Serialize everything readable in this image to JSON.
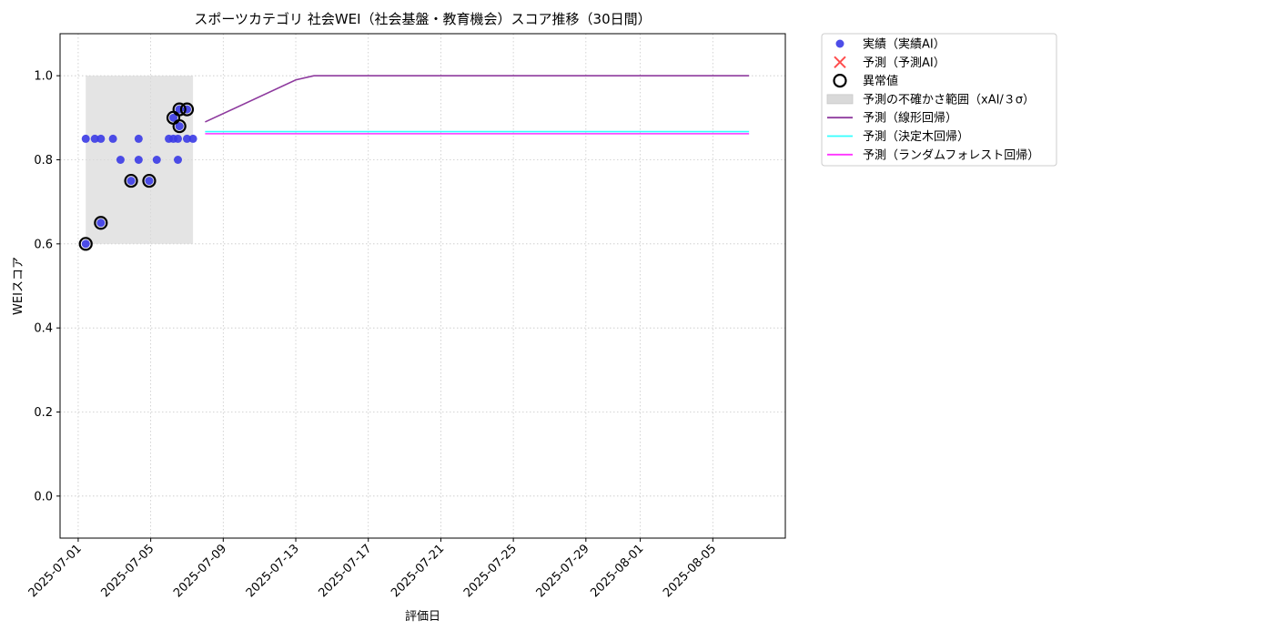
{
  "chart_data": {
    "type": "scatter",
    "title": "スポーツカテゴリ 社会WEI（社会基盤・教育機会）スコア推移（30日間）",
    "xlabel": "評価日",
    "ylabel": "WEIスコア",
    "xlim": [
      "2025-06-30",
      "2025-08-09"
    ],
    "ylim": [
      -0.1,
      1.1
    ],
    "yticks": [
      0.0,
      0.2,
      0.4,
      0.6,
      0.8,
      1.0
    ],
    "xticks": [
      "2025-07-01",
      "2025-07-05",
      "2025-07-09",
      "2025-07-13",
      "2025-07-17",
      "2025-07-21",
      "2025-07-25",
      "2025-07-29",
      "2025-08-01",
      "2025-08-05"
    ],
    "grid": true,
    "legend_position": "outside-top-right",
    "legend": [
      {
        "label": "実績（実績AI）",
        "kind": "dot",
        "color": "#3a3ae6"
      },
      {
        "label": "予測（予測AI）",
        "kind": "x",
        "color": "#ff4d4d"
      },
      {
        "label": "異常値",
        "kind": "ring",
        "color": "#000000"
      },
      {
        "label": "予測の不確かさ範囲（xAI/３σ）",
        "kind": "band",
        "color": "#d9d9d9"
      },
      {
        "label": "予測（線形回帰）",
        "kind": "line",
        "color": "#8e3a9e"
      },
      {
        "label": "予測（決定木回帰）",
        "kind": "line",
        "color": "#33ffff"
      },
      {
        "label": "予測（ランダムフォレスト回帰）",
        "kind": "line",
        "color": "#ff33ff"
      }
    ],
    "uncertainty_band": {
      "x": [
        "2025-07-01T10:00",
        "2025-07-07T08:00"
      ],
      "y": [
        0.6,
        1.0
      ]
    },
    "series": [
      {
        "name": "実績（実績AI）",
        "kind": "scatter",
        "color": "#3a3ae6",
        "points": [
          {
            "x": "2025-07-01T10:00",
            "y": 0.6
          },
          {
            "x": "2025-07-01T10:00",
            "y": 0.85
          },
          {
            "x": "2025-07-01T22:00",
            "y": 0.85
          },
          {
            "x": "2025-07-02T06:00",
            "y": 0.85
          },
          {
            "x": "2025-07-02T06:00",
            "y": 0.65
          },
          {
            "x": "2025-07-02T22:00",
            "y": 0.85
          },
          {
            "x": "2025-07-03T08:00",
            "y": 0.8
          },
          {
            "x": "2025-07-03T22:00",
            "y": 0.75
          },
          {
            "x": "2025-07-04T08:00",
            "y": 0.85
          },
          {
            "x": "2025-07-04T08:00",
            "y": 0.8
          },
          {
            "x": "2025-07-04T22:00",
            "y": 0.75
          },
          {
            "x": "2025-07-05T08:00",
            "y": 0.8
          },
          {
            "x": "2025-07-06T00:00",
            "y": 0.85
          },
          {
            "x": "2025-07-06T06:00",
            "y": 0.9
          },
          {
            "x": "2025-07-06T06:00",
            "y": 0.85
          },
          {
            "x": "2025-07-06T12:00",
            "y": 0.85
          },
          {
            "x": "2025-07-06T12:00",
            "y": 0.8
          },
          {
            "x": "2025-07-06T14:00",
            "y": 0.92
          },
          {
            "x": "2025-07-06T14:00",
            "y": 0.88
          },
          {
            "x": "2025-07-07T00:00",
            "y": 0.92
          },
          {
            "x": "2025-07-07T00:00",
            "y": 0.85
          },
          {
            "x": "2025-07-07T08:00",
            "y": 0.85
          }
        ]
      },
      {
        "name": "異常値",
        "kind": "ring",
        "color": "#000000",
        "points": [
          {
            "x": "2025-07-01T10:00",
            "y": 0.6
          },
          {
            "x": "2025-07-02T06:00",
            "y": 0.65
          },
          {
            "x": "2025-07-03T22:00",
            "y": 0.75
          },
          {
            "x": "2025-07-04T22:00",
            "y": 0.75
          },
          {
            "x": "2025-07-06T06:00",
            "y": 0.9
          },
          {
            "x": "2025-07-06T14:00",
            "y": 0.92
          },
          {
            "x": "2025-07-06T14:00",
            "y": 0.88
          },
          {
            "x": "2025-07-07T00:00",
            "y": 0.92
          }
        ]
      },
      {
        "name": "予測（線形回帰）",
        "kind": "line",
        "color": "#8e3a9e",
        "points": [
          {
            "x": "2025-07-08",
            "y": 0.89
          },
          {
            "x": "2025-07-13",
            "y": 0.99
          },
          {
            "x": "2025-07-14",
            "y": 1.0
          },
          {
            "x": "2025-08-07",
            "y": 1.0
          }
        ]
      },
      {
        "name": "予測（決定木回帰）",
        "kind": "line",
        "color": "#33ffff",
        "points": [
          {
            "x": "2025-07-08",
            "y": 0.867
          },
          {
            "x": "2025-08-07",
            "y": 0.867
          }
        ]
      },
      {
        "name": "予測（ランダムフォレスト回帰）",
        "kind": "line",
        "color": "#ff33ff",
        "points": [
          {
            "x": "2025-07-08",
            "y": 0.862
          },
          {
            "x": "2025-08-07",
            "y": 0.862
          }
        ]
      }
    ]
  }
}
